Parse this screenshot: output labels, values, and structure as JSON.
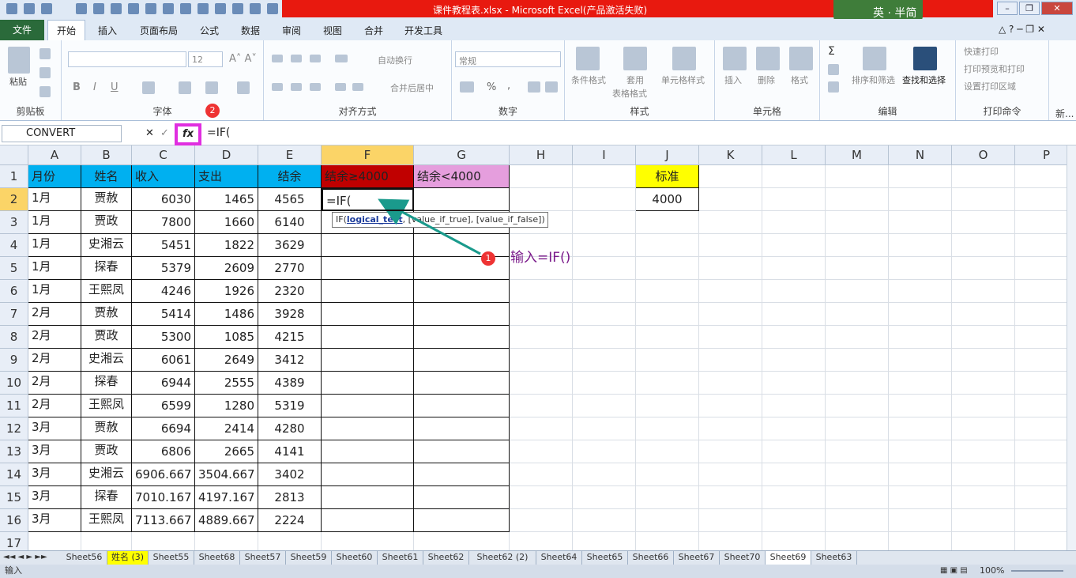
{
  "window": {
    "title": "课件教程表.xlsx - Microsoft Excel(产品激活失败)",
    "logo": "英 · 半简",
    "min": "–",
    "max": "❐",
    "close": "✕"
  },
  "ribbon_tabs": [
    "文件",
    "开始",
    "插入",
    "页面布局",
    "公式",
    "数据",
    "审阅",
    "视图",
    "合并",
    "开发工具"
  ],
  "ribbon": {
    "clipboard": {
      "paste": "粘贴",
      "label": "剪贴板"
    },
    "font": {
      "size": "12",
      "bold": "B",
      "italic": "I",
      "underline": "U",
      "label": "字体"
    },
    "align": {
      "wrap": "自动换行",
      "merge": "合并后居中",
      "label": "对齐方式"
    },
    "number": {
      "format": "常规",
      "percent": "%",
      "comma": ",",
      "label": "数字"
    },
    "styles": {
      "cond": "条件格式",
      "table1": "套用",
      "table2": "表格格式",
      "cell": "单元格样式",
      "label": "样式"
    },
    "cells": {
      "insert": "插入",
      "delete": "删除",
      "format": "格式",
      "label": "单元格"
    },
    "edit": {
      "sort": "排序和筛选",
      "find": "查找和选择",
      "label": "编辑"
    },
    "print": {
      "quick": "快速打印",
      "preview": "打印预览和打印",
      "area": "设置打印区域",
      "label": "打印命令"
    },
    "new": "新..."
  },
  "formula_bar": {
    "name_box": "CONVERT",
    "cancel": "✕",
    "confirm": "✓",
    "fx": "fx",
    "formula": "=IF("
  },
  "badges": {
    "b1": "1",
    "b2": "2"
  },
  "columns": [
    "A",
    "B",
    "C",
    "D",
    "E",
    "F",
    "G",
    "H",
    "I",
    "J",
    "K",
    "L",
    "M",
    "N",
    "O",
    "P"
  ],
  "rows": [
    "1",
    "2",
    "3",
    "4",
    "5",
    "6",
    "7",
    "8",
    "9",
    "10",
    "11",
    "12",
    "13",
    "14",
    "15",
    "16",
    "17"
  ],
  "table": {
    "headers": [
      "月份",
      "姓名",
      "收入",
      "支出",
      "结余",
      "结余≥4000",
      "结余<4000"
    ],
    "data": [
      [
        "1月",
        "贾赦",
        "6030",
        "1465",
        "4565"
      ],
      [
        "1月",
        "贾政",
        "7800",
        "1660",
        "6140"
      ],
      [
        "1月",
        "史湘云",
        "5451",
        "1822",
        "3629"
      ],
      [
        "1月",
        "探春",
        "5379",
        "2609",
        "2770"
      ],
      [
        "1月",
        "王熙凤",
        "4246",
        "1926",
        "2320"
      ],
      [
        "2月",
        "贾赦",
        "5414",
        "1486",
        "3928"
      ],
      [
        "2月",
        "贾政",
        "5300",
        "1085",
        "4215"
      ],
      [
        "2月",
        "史湘云",
        "6061",
        "2649",
        "3412"
      ],
      [
        "2月",
        "探春",
        "6944",
        "2555",
        "4389"
      ],
      [
        "2月",
        "王熙凤",
        "6599",
        "1280",
        "5319"
      ],
      [
        "3月",
        "贾赦",
        "6694",
        "2414",
        "4280"
      ],
      [
        "3月",
        "贾政",
        "6806",
        "2665",
        "4141"
      ],
      [
        "3月",
        "史湘云",
        "6906.667",
        "3504.667",
        "3402"
      ],
      [
        "3月",
        "探春",
        "7010.167",
        "4197.167",
        "2813"
      ],
      [
        "3月",
        "王熙凤",
        "7113.667",
        "4889.667",
        "2224"
      ]
    ],
    "edit_cell": "=IF("
  },
  "standard": {
    "label": "标准",
    "value": "4000"
  },
  "tooltip": {
    "fn": "IF(",
    "arg1": "logical_test",
    "rest": ", [value_if_true], [value_if_false])"
  },
  "annotation": "输入=IF()",
  "sheets": [
    "Sheet56",
    "姓名 (3)",
    "Sheet55",
    "Sheet68",
    "Sheet57",
    "Sheet59",
    "Sheet60",
    "Sheet61",
    "Sheet62",
    "Sheet62 (2)",
    "Sheet64",
    "Sheet65",
    "Sheet66",
    "Sheet67",
    "Sheet70",
    "Sheet69",
    "Sheet63"
  ],
  "status": {
    "mode": "输入",
    "zoom": "100%"
  },
  "colors": {
    "header_blue": "#00b0f0",
    "header_red": "#c00000",
    "header_pink": "#e59edd",
    "standard_yellow": "#ffff00",
    "arrow": "#1a9a8c"
  }
}
